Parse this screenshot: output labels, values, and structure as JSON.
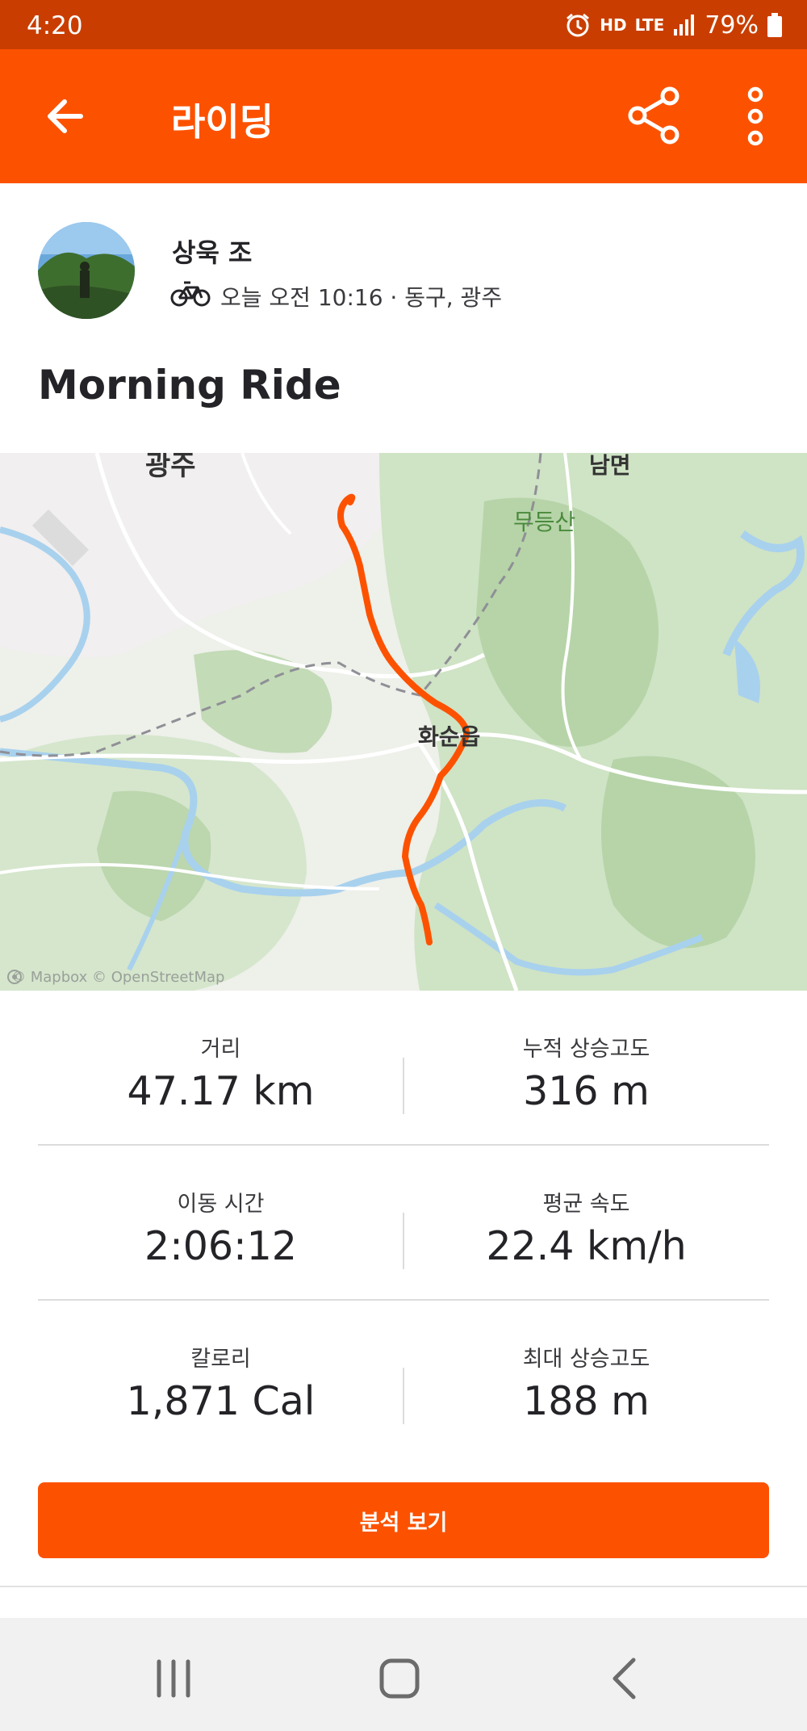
{
  "status_bar": {
    "time": "4:20",
    "network_hd": "HD",
    "network_lte": "LTE",
    "battery": "79%"
  },
  "app_bar": {
    "title": "라이딩",
    "back_icon": "arrow-left-icon",
    "share_icon": "share-icon",
    "more_icon": "more-vertical-icon"
  },
  "athlete": {
    "name": "상욱 조",
    "activity_icon": "bicycle-icon",
    "meta": "오늘 오전 10:16 · 동구, 광주"
  },
  "activity": {
    "title": "Morning Ride"
  },
  "map": {
    "labels": {
      "city_top_left": "광주",
      "top_right": "남면",
      "mountain": "무등산",
      "town": "화순읍"
    },
    "credit": "© Mapbox © OpenStreetMap",
    "route_color": "#fc5200"
  },
  "stats": [
    {
      "left": {
        "label": "거리",
        "value": "47.17 km"
      },
      "right": {
        "label": "누적 상승고도",
        "value": "316 m"
      }
    },
    {
      "left": {
        "label": "이동 시간",
        "value": "2:06:12"
      },
      "right": {
        "label": "평균 속도",
        "value": "22.4 km/h"
      }
    },
    {
      "left": {
        "label": "칼로리",
        "value": "1,871 Cal"
      },
      "right": {
        "label": "최대 상승고도",
        "value": "188 m"
      }
    }
  ],
  "analysis_button": {
    "label": "분석 보기"
  },
  "nav_bar": {
    "recents_icon": "recents-icon",
    "home_icon": "home-icon",
    "back_icon": "nav-back-icon"
  },
  "colors": {
    "brand_orange": "#fc5200",
    "status_bar": "#c93e00"
  }
}
